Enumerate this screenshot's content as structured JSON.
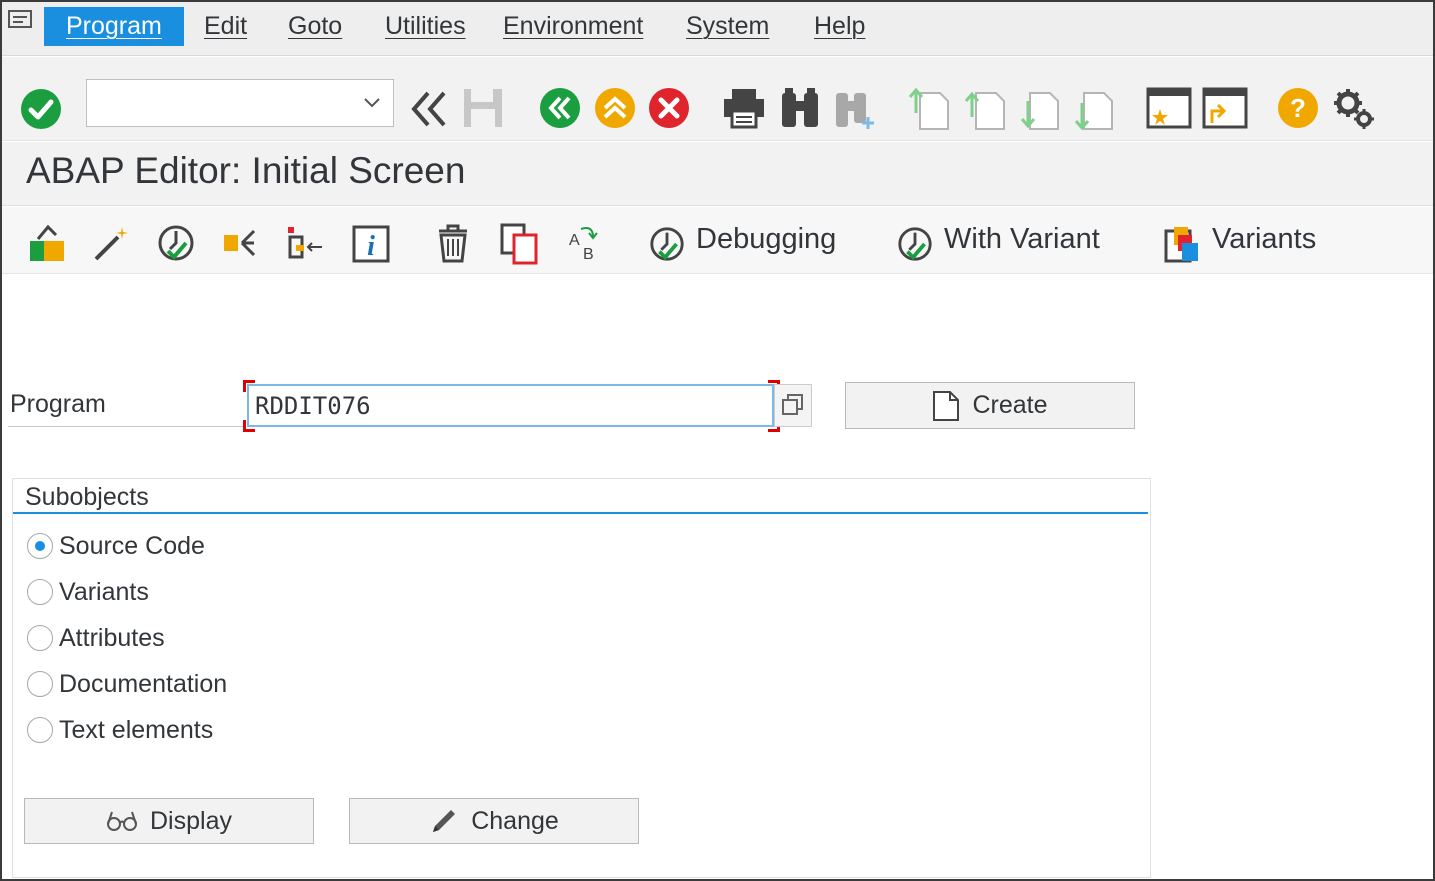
{
  "menu": {
    "items": [
      {
        "label": "Program"
      },
      {
        "label": "Edit"
      },
      {
        "label": "Goto"
      },
      {
        "label": "Utilities"
      },
      {
        "label": "Environment"
      },
      {
        "label": "System"
      },
      {
        "label": "Help"
      }
    ],
    "active": "Program"
  },
  "toolbar": {
    "command_field_value": "",
    "icons": [
      "enter-icon",
      "back-double-icon",
      "save-icon",
      "back-icon",
      "exit-icon",
      "cancel-icon",
      "print-icon",
      "find-icon",
      "find-next-icon",
      "first-page-icon",
      "previous-page-icon",
      "next-page-icon",
      "last-page-icon",
      "create-session-icon",
      "shortcut-icon",
      "help-icon",
      "customize-layout-icon"
    ]
  },
  "title": "ABAP Editor: Initial Screen",
  "app_toolbar": {
    "debugging": "Debugging",
    "with_variant": "With Variant",
    "variants": "Variants"
  },
  "form": {
    "program_label": "Program",
    "program_value": "RDDIT076",
    "create_label": "Create"
  },
  "subobjects": {
    "title": "Subobjects",
    "options": [
      {
        "label": "Source Code",
        "checked": true
      },
      {
        "label": "Variants",
        "checked": false
      },
      {
        "label": "Attributes",
        "checked": false
      },
      {
        "label": "Documentation",
        "checked": false
      },
      {
        "label": "Text elements",
        "checked": false
      }
    ]
  },
  "actions": {
    "display": "Display",
    "change": "Change"
  },
  "colors": {
    "accent": "#1a8fe0",
    "green": "#1a9e3f",
    "orange": "#f0a800",
    "red": "#e0242e"
  }
}
